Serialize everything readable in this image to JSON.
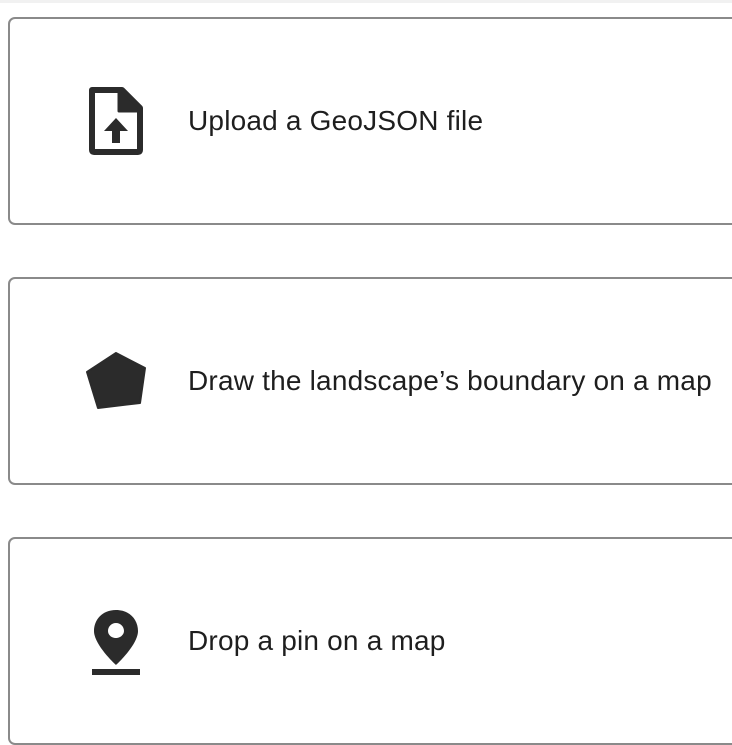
{
  "options": [
    {
      "label": "Upload a GeoJSON file",
      "icon": "upload-file-icon"
    },
    {
      "label": "Draw the landscape’s boundary on a map",
      "icon": "pentagon-icon"
    },
    {
      "label": "Drop a pin on a map",
      "icon": "map-pin-icon"
    }
  ],
  "colors": {
    "icon": "#2b2b2b",
    "border": "#8a8a8a",
    "text": "#1e1e1e"
  }
}
